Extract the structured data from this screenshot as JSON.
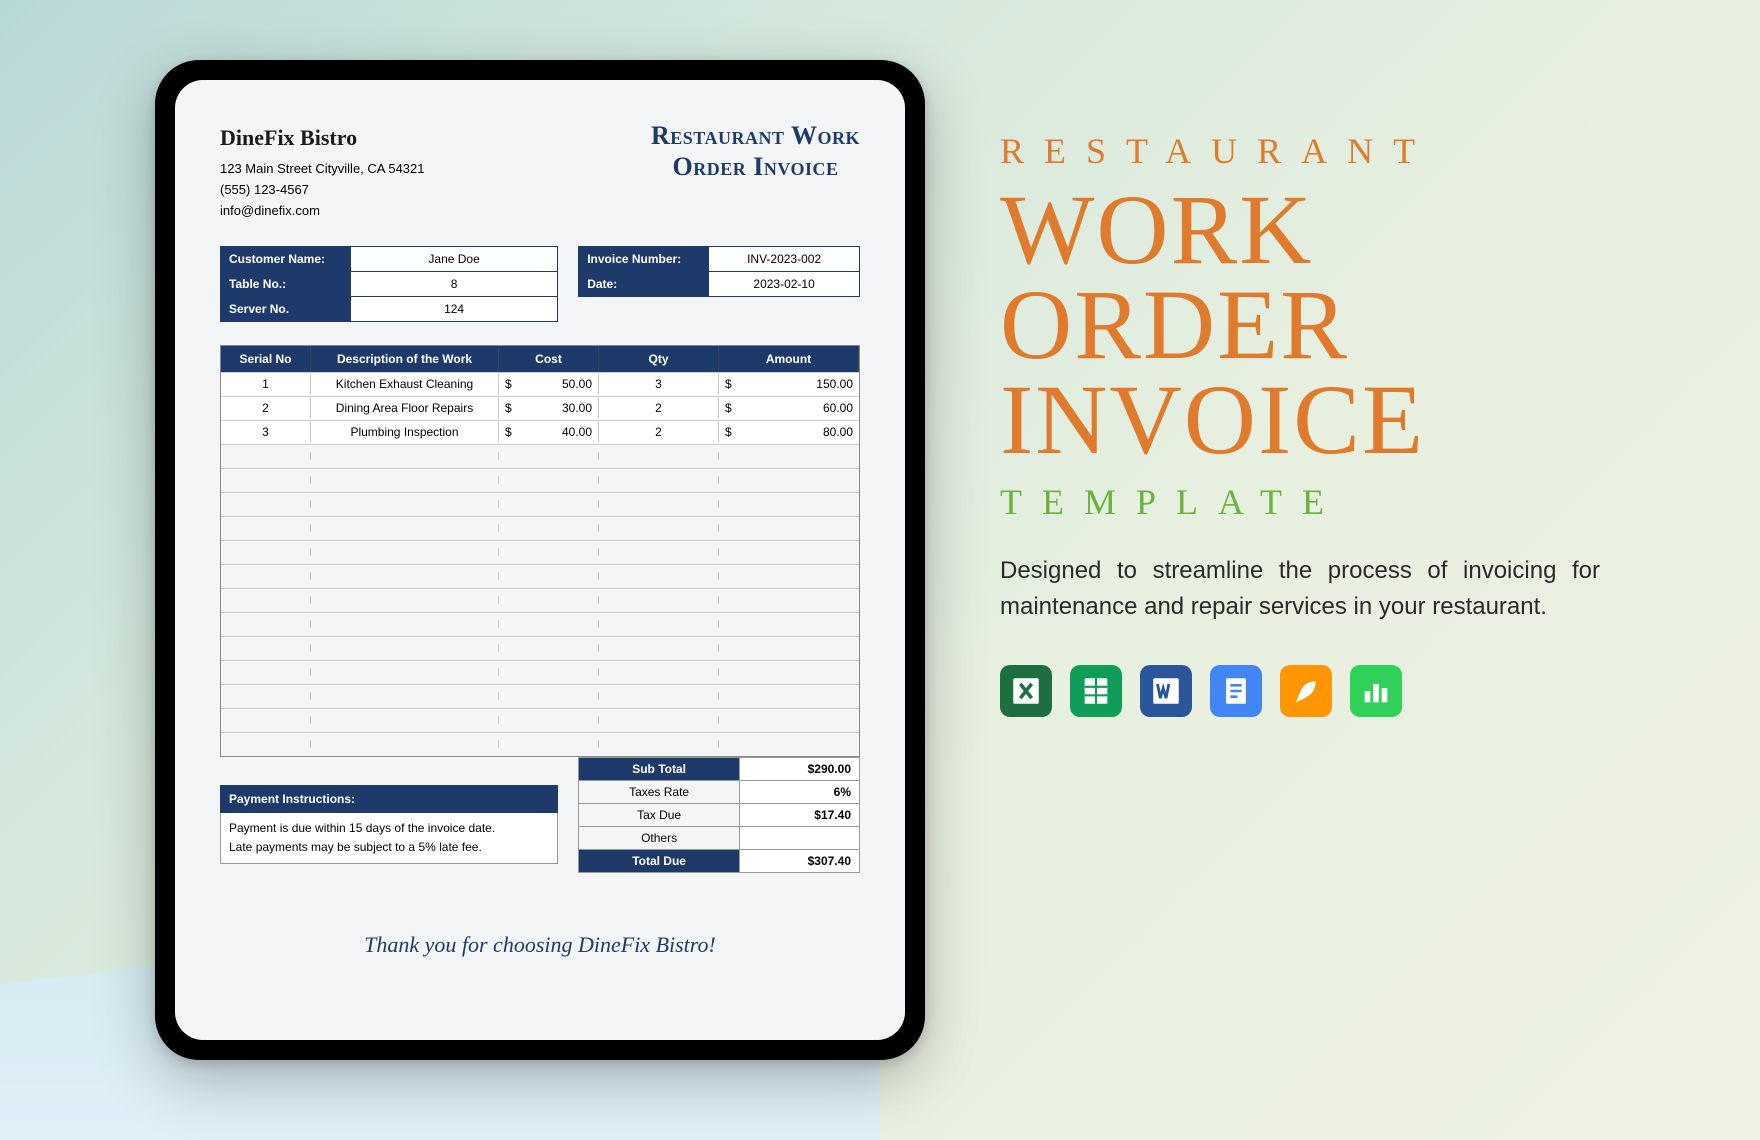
{
  "company": {
    "name": "DineFix Bistro",
    "address": "123 Main Street Cityville, CA 54321",
    "phone": "(555) 123-4567",
    "email": "info@dinefix.com"
  },
  "doc_title": {
    "line1": "Restaurant Work",
    "line2": "Order Invoice"
  },
  "customer_info": {
    "labels": {
      "customer": "Customer Name:",
      "table": "Table No.:",
      "server": "Server No."
    },
    "customer": "Jane Doe",
    "table": "8",
    "server": "124"
  },
  "invoice_info": {
    "labels": {
      "number": "Invoice Number:",
      "date": "Date:"
    },
    "number": "INV-2023-002",
    "date": "2023-02-10"
  },
  "columns": {
    "serial": "Serial No",
    "desc": "Description of the Work",
    "cost": "Cost",
    "qty": "Qty",
    "amount": "Amount"
  },
  "lines": [
    {
      "serial": "1",
      "desc": "Kitchen Exhaust Cleaning",
      "cost": "50.00",
      "qty": "3",
      "amount": "150.00"
    },
    {
      "serial": "2",
      "desc": "Dining Area Floor Repairs",
      "cost": "30.00",
      "qty": "2",
      "amount": "60.00"
    },
    {
      "serial": "3",
      "desc": "Plumbing Inspection",
      "cost": "40.00",
      "qty": "2",
      "amount": "80.00"
    }
  ],
  "empty_rows": 13,
  "payment": {
    "heading": "Payment Instructions:",
    "line1": "Payment is due within 15 days of the invoice date.",
    "line2": "Late payments may be subject to a 5% late fee."
  },
  "totals": {
    "labels": {
      "subtotal": "Sub Total",
      "taxrate": "Taxes Rate",
      "taxdue": "Tax Due",
      "others": "Others",
      "totaldue": "Total Due"
    },
    "subtotal": "$290.00",
    "taxrate": "6%",
    "taxdue": "$17.40",
    "others": "",
    "totaldue": "$307.40"
  },
  "thank_you": "Thank you for choosing DineFix Bistro!",
  "marketing": {
    "word1": "RESTAURANT",
    "big1": "WORK",
    "big2": "ORDER",
    "big3": "INVOICE",
    "word2": "TEMPLATE",
    "description": "Designed to streamline the process of invoicing for maintenance and repair services in your restaurant."
  },
  "icons": {
    "excel": "excel-icon",
    "sheets": "sheets-icon",
    "word": "word-icon",
    "docs": "docs-icon",
    "pages": "pages-icon",
    "numbers": "numbers-icon"
  },
  "currency": "$"
}
